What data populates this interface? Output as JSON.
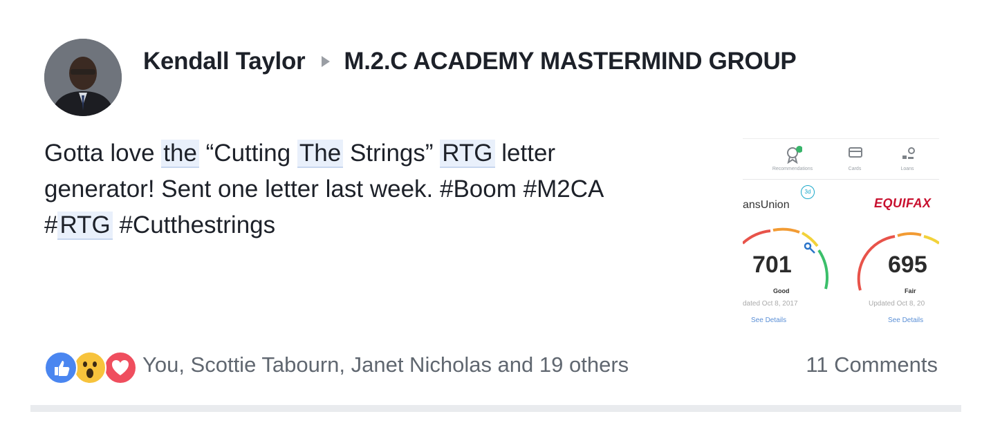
{
  "post": {
    "author": "Kendall Taylor",
    "group": "M.2.C ACADEMY MASTERMIND GROUP",
    "text": {
      "l1a": "Gotta love ",
      "h1": "the",
      "l1b": " “Cutting ",
      "h2": "The",
      "l1c": " Strings” ",
      "h3": "RTG",
      "l1d": " letter",
      "l2": "generator! Sent one letter last week. ",
      "tag_boom": "#Boom",
      "tag_m2ca": "#M2CA",
      "tag_rtg_hash": "#",
      "tag_rtg_word": "RTG",
      "tag_cut": "#Cutthestrings"
    },
    "attachment": {
      "nav": [
        {
          "label": "Recommendations",
          "icon": "award-icon",
          "badge": "1"
        },
        {
          "label": "Cards",
          "icon": "credit-card-icon"
        },
        {
          "label": "Loans",
          "icon": "loan-icon"
        }
      ],
      "bureau1": "ansUnion",
      "bureau1_badge": "3d",
      "bureau2": "EQUIFAX",
      "score1": "701",
      "rating1": "Good",
      "updated1": "dated Oct 8, 2017",
      "see1": "See Details",
      "score2": "695",
      "rating2": "Fair",
      "updated2": "Updated Oct 8, 20",
      "see2": "See Details"
    },
    "reactions": [
      "like-icon",
      "wow-icon",
      "love-icon"
    ],
    "reactors": "You, Scottie Tabourn, Janet Nicholas and 19 others",
    "comments": "11 Comments"
  }
}
